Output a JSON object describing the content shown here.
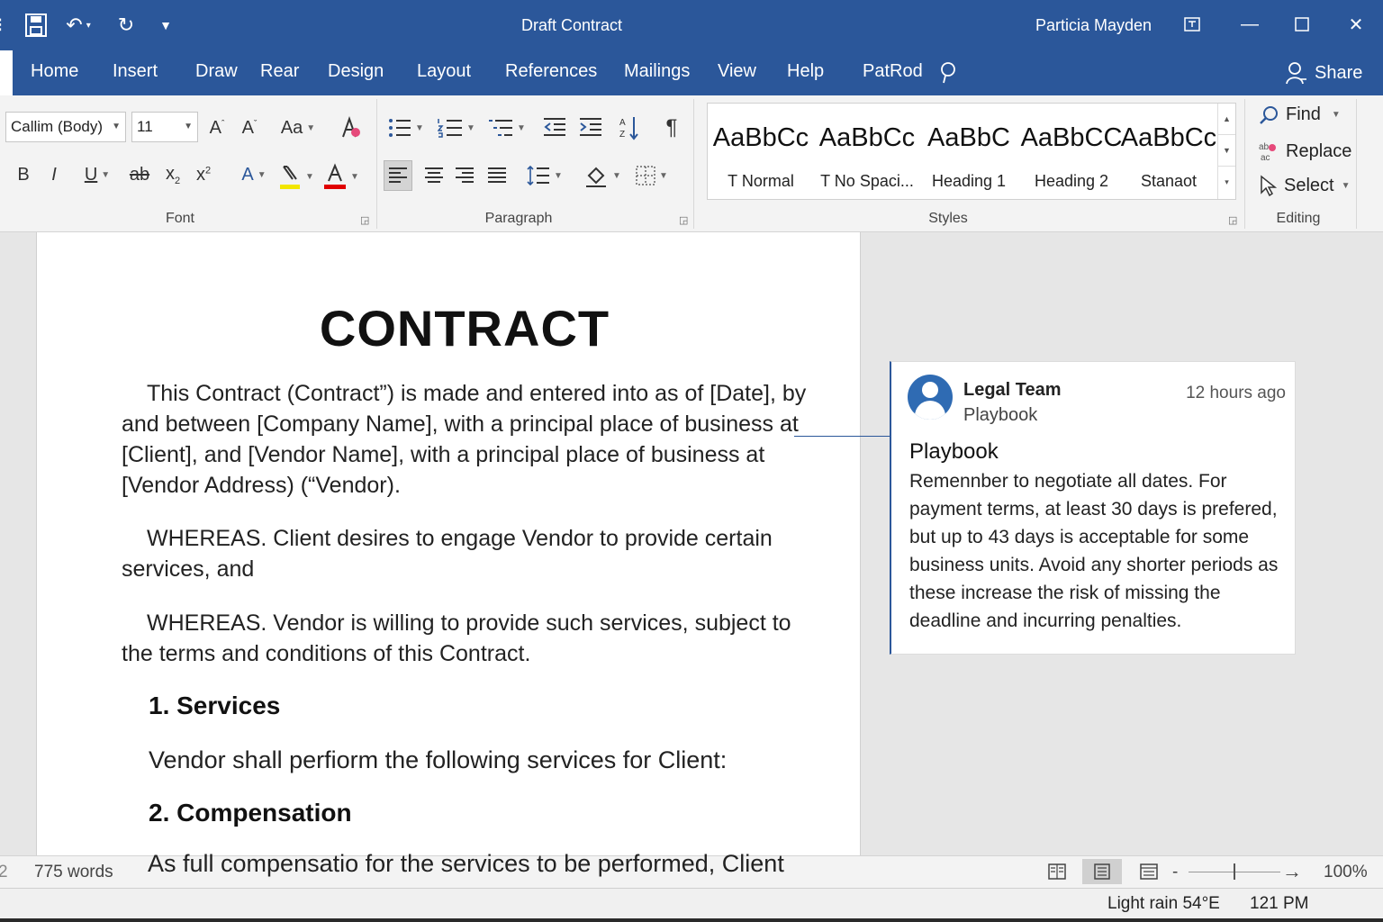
{
  "app": {
    "document_title": "Draft Contract",
    "user_name": "Particia Mayden"
  },
  "tabs": [
    "Home",
    "Insert",
    "Draw",
    "Rear",
    "Design",
    "Layout",
    "References",
    "Mailings",
    "View",
    "Help",
    "PatRod"
  ],
  "share_label": "Share",
  "ribbon": {
    "font": {
      "font_name": "Callim (Body)",
      "font_size": "11",
      "group_label": "Font"
    },
    "paragraph": {
      "group_label": "Paragraph"
    },
    "styles": {
      "group_label": "Styles",
      "items": [
        {
          "sample": "AaBbCc",
          "name": "T Normal"
        },
        {
          "sample": "AaBbCc",
          "name": "T No Spaci..."
        },
        {
          "sample": "AaBbC",
          "name": "Heading 1"
        },
        {
          "sample": "AaBbCC",
          "name": "Heading 2"
        },
        {
          "sample": "AaBbCc",
          "name": "Stanaot"
        }
      ]
    },
    "editing": {
      "group_label": "Editing",
      "find": "Find",
      "replace": "Replace",
      "select": "Select"
    }
  },
  "document": {
    "heading": "CONTRACT",
    "intro": "This Contract (Contract”) is made and entered into as of [Date], by and between [Company Name], with a principal place of business at [Client], and [Vendor Name], with a principal place of business at [Vendor Address) (“Vendor).",
    "whereas1": "WHEREAS. Client desires to engage Vendor to provide certain services, and",
    "whereas2": "WHEREAS. Vendor is willing to provide such services, subject to the terms and conditions of this Contract.",
    "section1_title": "1. Services",
    "section1_body": "Vendor shall perfiorm the following services for Client:",
    "section2_title": "2. Compensation",
    "section2_body": "As full compensatio for the services to be performed, Client"
  },
  "comment": {
    "author": "Legal Team",
    "subtitle": "Playbook",
    "time": "12 hours ago",
    "title": "Playbook",
    "body": "Remennber to negotiate all dates. For payment terms, at least 30 days is prefered, but up to 43 days is acceptable for some business units. Avoid any shorter periods as these increase the risk of missing the deadline and incurring penalties."
  },
  "statusbar": {
    "page_fragment": "2",
    "word_count": "775 words",
    "zoom_percent": "100%"
  },
  "taskbar": {
    "weather": "Light rain 54°E",
    "clock": "121 PM"
  },
  "colors": {
    "brand": "#2b579a",
    "font_color_bar": "#e00000",
    "highlight_bar": "#f2e600"
  }
}
